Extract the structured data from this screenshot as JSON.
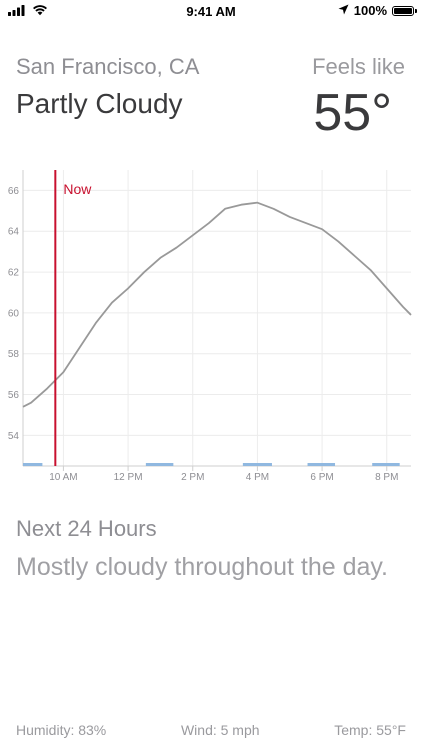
{
  "status_bar": {
    "time": "9:41 AM",
    "battery": "100%",
    "battery_level": 1.0,
    "icons": [
      "signal-icon",
      "wifi-icon",
      "location-arrow-icon",
      "battery-icon"
    ]
  },
  "header": {
    "city": "San Francisco, CA",
    "condition": "Partly Cloudy",
    "feels_like_label": "Feels like",
    "feels_like_value": "55°"
  },
  "chart_data": {
    "type": "line",
    "series": [
      {
        "color": "#999999",
        "x": [
          8.75,
          9.0,
          9.5,
          10.0,
          10.5,
          11.0,
          11.5,
          12.0,
          12.5,
          13.0,
          13.5,
          14.0,
          14.5,
          15.0,
          15.5,
          16.0,
          16.5,
          17.0,
          17.5,
          18.0,
          18.5,
          19.0,
          19.5,
          20.0,
          20.5,
          20.75
        ],
        "y": [
          55.4,
          55.6,
          56.3,
          57.1,
          58.3,
          59.5,
          60.5,
          61.2,
          62.0,
          62.7,
          63.2,
          63.8,
          64.4,
          65.1,
          65.3,
          65.4,
          65.1,
          64.7,
          64.4,
          64.1,
          63.5,
          62.8,
          62.1,
          61.2,
          60.3,
          59.9
        ]
      }
    ],
    "now_x": 9.75,
    "now_label": "Now",
    "now_color": "#c8102e",
    "xlim": [
      8.75,
      20.75
    ],
    "ylim": [
      52.5,
      67
    ],
    "x_ticks": [
      {
        "value": 10,
        "label": "10 AM"
      },
      {
        "value": 12,
        "label": "12 PM"
      },
      {
        "value": 14,
        "label": "2 PM"
      },
      {
        "value": 16,
        "label": "4 PM"
      },
      {
        "value": 18,
        "label": "6 PM"
      },
      {
        "value": 20,
        "label": "8 PM"
      }
    ],
    "y_ticks": [
      54,
      56,
      58,
      60,
      62,
      64,
      66
    ],
    "grid": true,
    "precip_bars": [
      {
        "start": 8.75,
        "end": 9.35
      },
      {
        "start": 12.55,
        "end": 13.4
      },
      {
        "start": 15.55,
        "end": 16.45
      },
      {
        "start": 17.55,
        "end": 18.4
      },
      {
        "start": 19.55,
        "end": 20.4
      }
    ],
    "precip_color": "#90b8e0"
  },
  "summary": {
    "title": "Next 24 Hours",
    "text": "Mostly cloudy throughout the day."
  },
  "footer": {
    "humidity": "Humidity: 83%",
    "wind": "Wind: 5 mph",
    "temp": "Temp: 55°F"
  }
}
